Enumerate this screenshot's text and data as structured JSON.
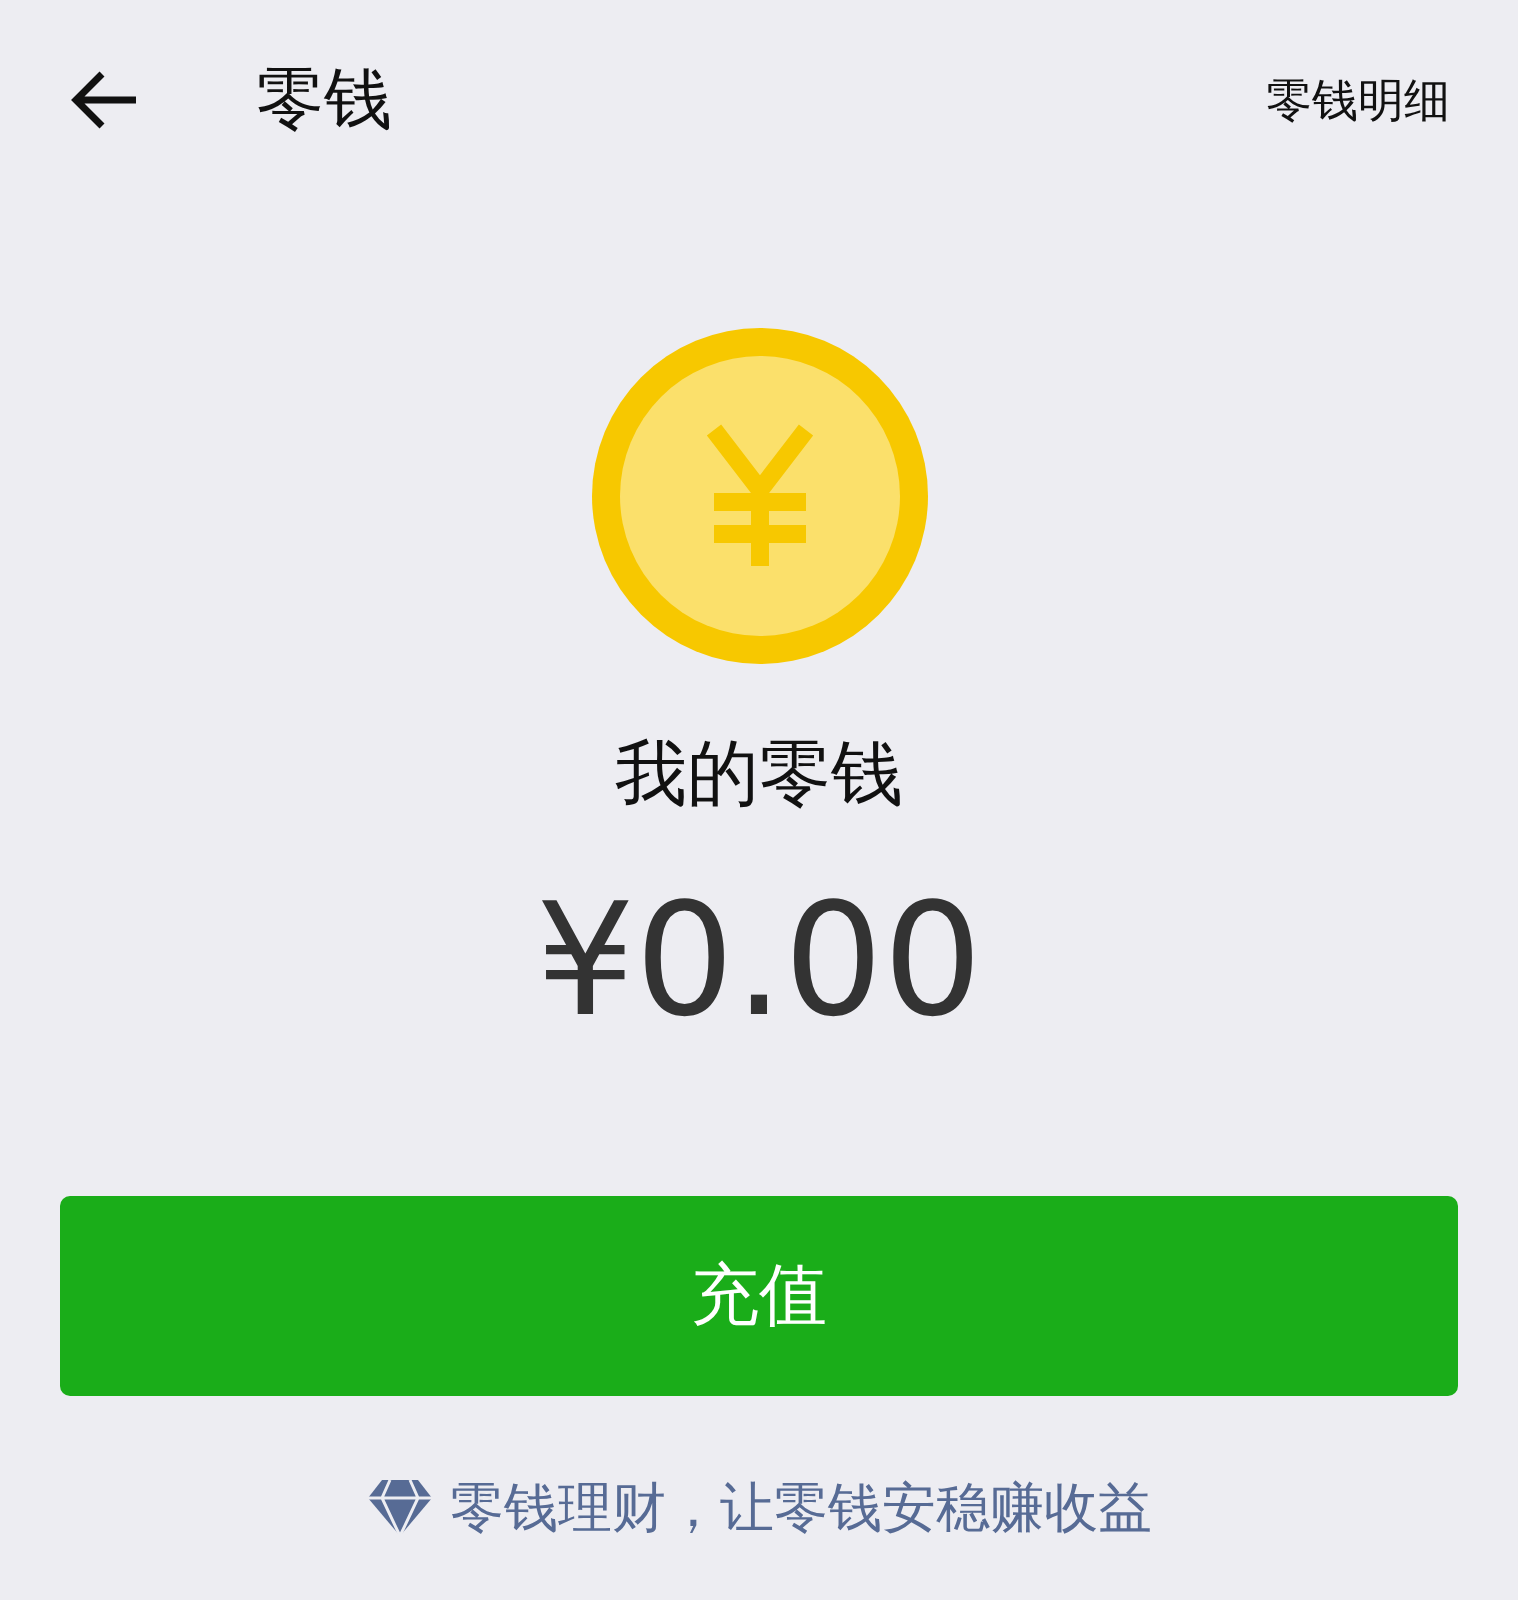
{
  "header": {
    "title": "零钱",
    "action": "零钱明细"
  },
  "balance": {
    "label": "我的零钱",
    "amount": "¥0.00"
  },
  "button": {
    "label": "充值"
  },
  "promo_link": {
    "text": "零钱理财，让零钱安稳赚收益"
  }
}
